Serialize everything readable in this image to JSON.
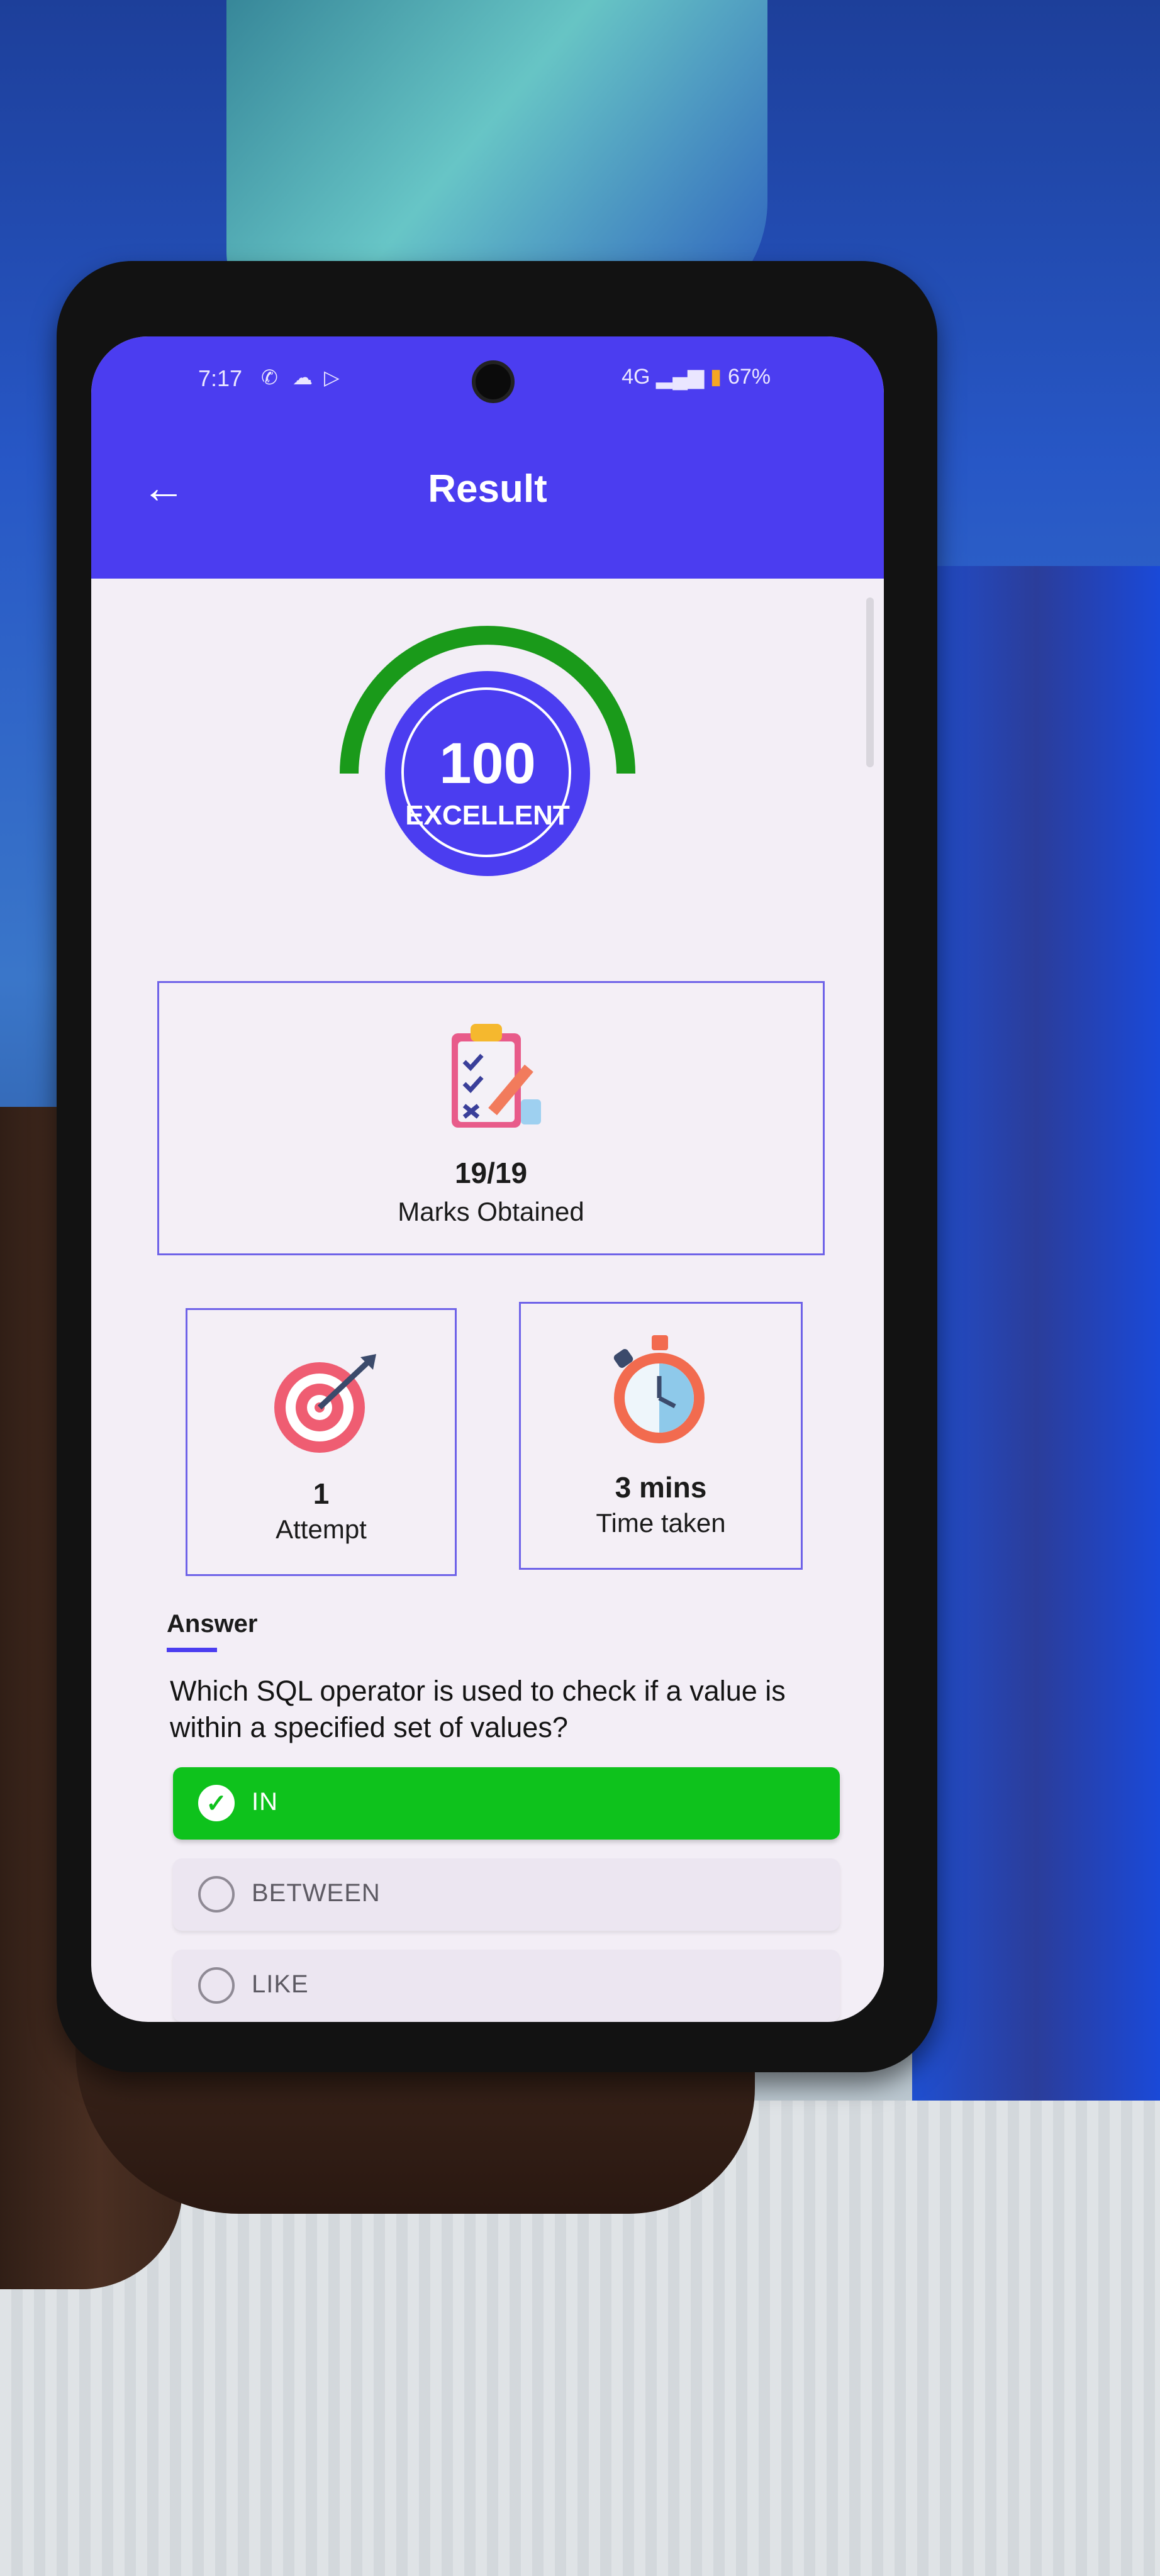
{
  "status_bar": {
    "time": "7:17",
    "network": "4G",
    "battery": "67%"
  },
  "header": {
    "title": "Result",
    "back_icon": "arrow-left-icon"
  },
  "result": {
    "score": "100",
    "grade": "EXCELLENT",
    "gauge_fraction": 1.0,
    "gauge_color": "#1a9a1a"
  },
  "stats": {
    "marks": {
      "value": "19/19",
      "label": "Marks Obtained"
    },
    "attempt": {
      "value": "1",
      "label": "Attempt"
    },
    "time": {
      "value": "3 mins",
      "label": "Time taken"
    }
  },
  "answer": {
    "section_label": "Answer",
    "question": "Which SQL operator is used to check if a value is within a specified set of values?",
    "options": [
      {
        "label": "IN",
        "selected": true
      },
      {
        "label": "BETWEEN",
        "selected": false
      },
      {
        "label": "LIKE",
        "selected": false
      }
    ]
  },
  "colors": {
    "primary": "#4b3df0",
    "correct": "#0ec21c",
    "background": "#f3eef6"
  }
}
